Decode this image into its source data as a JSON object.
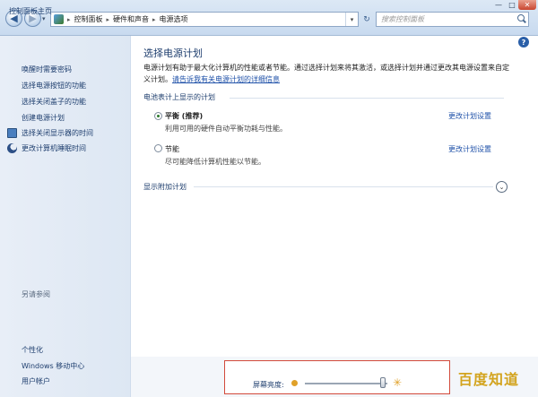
{
  "window": {
    "minimize": "—",
    "maximize": "□",
    "close": "✕"
  },
  "address": {
    "breadcrumbs": [
      "控制面板",
      "硬件和声音",
      "电源选项"
    ],
    "separator": "▸",
    "dropdown": "▾",
    "refresh": "↻",
    "search_placeholder": "搜索控制面板"
  },
  "sidebar": {
    "home": "控制面板主页",
    "links": [
      "唤醒时需要密码",
      "选择电源按钮的功能",
      "选择关闭盖子的功能",
      "创建电源计划",
      "选择关闭显示器的时间",
      "更改计算机睡眠时间"
    ],
    "see_also_title": "另请参阅",
    "see_also": [
      "个性化",
      "Windows 移动中心",
      "用户帐户"
    ]
  },
  "main": {
    "help": "?",
    "title": "选择电源计划",
    "description": "电源计划有助于最大化计算机的性能或者节能。通过选择计划来将其激活，或选择计划并通过更改其电源设置来自定义计划。",
    "description_link": "请告诉我有关电源计划的详细信息",
    "battery_section": "电池表计上显示的计划",
    "plans": [
      {
        "name": "平衡 (推荐)",
        "desc": "利用可用的硬件自动平衡功耗与性能。",
        "link": "更改计划设置",
        "selected": true
      },
      {
        "name": "节能",
        "desc": "尽可能降低计算机性能以节能。",
        "link": "更改计划设置",
        "selected": false
      }
    ],
    "more_plans": "显示附加计划",
    "more_icon": "⌄"
  },
  "brightness": {
    "label": "屏幕亮度:",
    "level_percent": 95,
    "sun_icon": "✳"
  },
  "watermark": "百度知道"
}
